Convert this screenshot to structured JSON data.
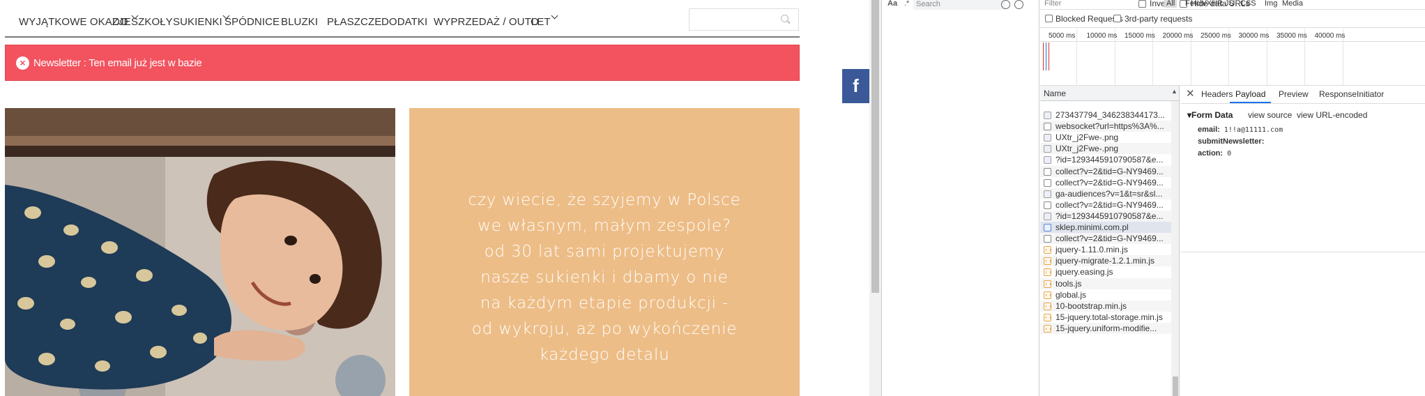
{
  "site": {
    "nav": [
      {
        "label": "WYJĄTKOWE OKAZJE",
        "dropdown": true
      },
      {
        "label": "DO SZKOŁY",
        "dropdown": false
      },
      {
        "label": "SUKIENKI",
        "dropdown": true
      },
      {
        "label": "SPÓDNICE",
        "dropdown": false
      },
      {
        "label": "BLUZKI",
        "dropdown": false
      },
      {
        "label": "PŁASZCZE",
        "dropdown": false
      },
      {
        "label": "DODATKI",
        "dropdown": false
      },
      {
        "label": "WYPRZEDAŻ / OUTLET",
        "dropdown": true
      },
      {
        "label": "O",
        "dropdown": false
      }
    ],
    "search": {
      "value": "",
      "placeholder": ""
    },
    "alert": {
      "message": "Newsletter : Ten email już jest w bazie",
      "color": "#f2535f"
    },
    "promo": {
      "lines": [
        "czy wiecie, że szyjemy w Polsce",
        "we własnym, małym zespole?",
        "od 30 lat sami projektujemy",
        "nasze sukienki i dbamy o nie",
        "na każdym etapie produkcji -",
        "od wykroju, aż po wykończenie",
        "każdego detalu"
      ],
      "background": "#edbd87"
    },
    "facebook": {
      "label": "f",
      "color": "#3b5998"
    }
  },
  "devtools": {
    "left_toolbar": {
      "case_label": "Aa",
      "regex_label": ".*",
      "search_placeholder": "Search"
    },
    "filter": {
      "placeholder": "Filter"
    },
    "toolbar": {
      "invert_label": "Invert",
      "hide_data_urls_label": "Hide data URLs",
      "types": [
        "All",
        "Fetch/XHR",
        "JS",
        "CSS",
        "Img",
        "Media"
      ],
      "active_type": "All",
      "blocked_label": "Blocked Requests",
      "third_party_label": "3rd-party requests"
    },
    "timeline_ticks": [
      "5000 ms",
      "10000 ms",
      "15000 ms",
      "20000 ms",
      "25000 ms",
      "30000 ms",
      "35000 ms",
      "40000 ms"
    ],
    "list_header": "Name",
    "requests": [
      {
        "name": "273437794_346238344173...",
        "type": "img"
      },
      {
        "name": "websocket?url=https%3A%...",
        "type": "other"
      },
      {
        "name": "UXtr_j2Fwe-.png",
        "type": "img"
      },
      {
        "name": "UXtr_j2Fwe-.png",
        "type": "img"
      },
      {
        "name": "?id=1293445910790587&e...",
        "type": "img"
      },
      {
        "name": "collect?v=2&tid=G-NY9469...",
        "type": "other"
      },
      {
        "name": "collect?v=2&tid=G-NY9469...",
        "type": "other"
      },
      {
        "name": "ga-audiences?v=1&t=sr&sl...",
        "type": "img"
      },
      {
        "name": "collect?v=2&tid=G-NY9469...",
        "type": "other"
      },
      {
        "name": "?id=1293445910790587&e...",
        "type": "img"
      },
      {
        "name": "sklep.minimi.com.pl",
        "type": "doc",
        "selected": true
      },
      {
        "name": "collect?v=2&tid=G-NY9469...",
        "type": "other"
      },
      {
        "name": "jquery-1.11.0.min.js",
        "type": "js"
      },
      {
        "name": "jquery-migrate-1.2.1.min.js",
        "type": "js"
      },
      {
        "name": "jquery.easing.js",
        "type": "js"
      },
      {
        "name": "tools.js",
        "type": "js"
      },
      {
        "name": "global.js",
        "type": "js"
      },
      {
        "name": "10-bootstrap.min.js",
        "type": "js"
      },
      {
        "name": "15-jquery.total-storage.min.js",
        "type": "js"
      },
      {
        "name": "15-jquery.uniform-modifie...",
        "type": "js"
      }
    ],
    "detail": {
      "close_label": "✕",
      "tabs": [
        "Headers",
        "Payload",
        "Preview",
        "Response",
        "Initiator"
      ],
      "active_tab": "Payload",
      "section_title": "▾Form Data",
      "view_source": "view source",
      "view_url_encoded": "view URL-encoded",
      "fields": [
        {
          "key": "email:",
          "value": "1!!a@11111.com"
        },
        {
          "key": "submitNewsletter:",
          "value": ""
        },
        {
          "key": "action:",
          "value": "0"
        }
      ]
    }
  }
}
